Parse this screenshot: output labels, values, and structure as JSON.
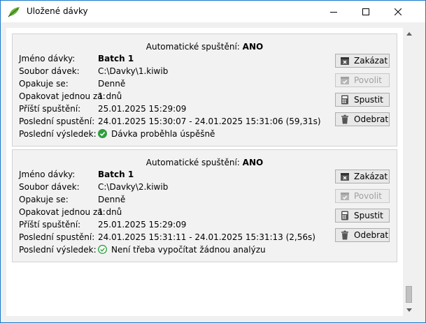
{
  "window": {
    "title": "Uložené dávky",
    "controls": {
      "minimize": "minimize-icon",
      "maximize": "maximize-icon",
      "close": "close-icon"
    }
  },
  "labels": {
    "auto_prefix": "Automatické spuštění:",
    "name": "Jméno dávky:",
    "file": "Soubor dávek:",
    "repeats": "Opakuje se:",
    "repeat_every": "Opakovat jednou za:",
    "next_run": "Příští spuštění:",
    "last_run": "Poslední spustění:",
    "last_result": "Poslední výsledek:"
  },
  "buttons": {
    "disable": "Zakázat",
    "enable": "Povolit",
    "run": "Spustit",
    "remove": "Odebrat"
  },
  "batches": [
    {
      "auto": "ANO",
      "name": "Batch 1",
      "file": "C:\\Davky\\1.kiwib",
      "repeats": "Denně",
      "repeat_every": "1 dnů",
      "next_run": "25.01.2025 15:29:09",
      "last_run": "24.01.2025 15:30:07 - 24.01.2025 15:31:06 (59,31s)",
      "last_result": "Dávka proběhla úspěšně",
      "result_icon": "success-check-icon"
    },
    {
      "auto": "ANO",
      "name": "Batch 1",
      "file": "C:\\Davky\\2.kiwib",
      "repeats": "Denně",
      "repeat_every": "1 dnů",
      "next_run": "25.01.2025 15:29:09",
      "last_run": "24.01.2025 15:31:11 - 24.01.2025 15:31:13 (2,56s)",
      "last_result": "Není třeba vypočítat žádnou analýzu",
      "result_icon": "outline-check-icon"
    }
  ],
  "colors": {
    "success": "#2e9e3e",
    "window_border": "#1979ca"
  }
}
